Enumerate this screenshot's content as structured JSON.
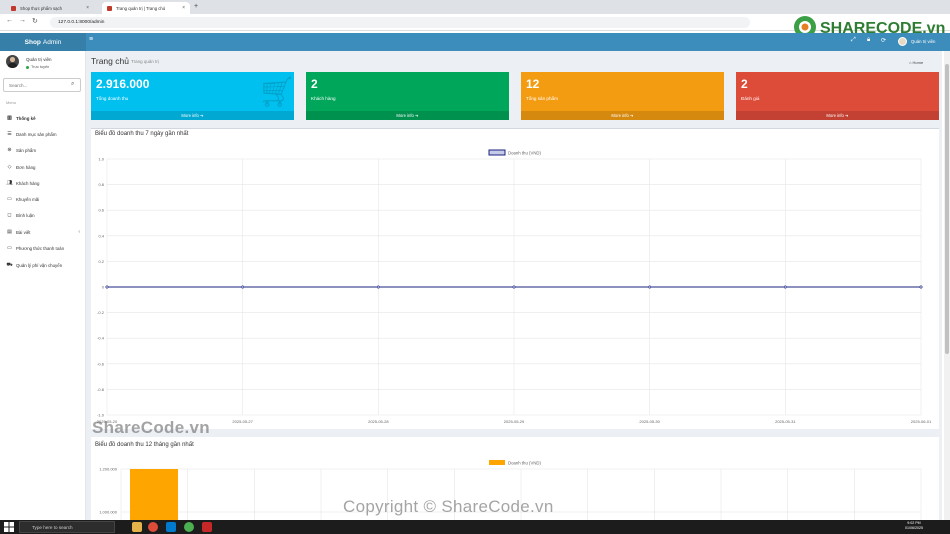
{
  "browser": {
    "tabs": [
      {
        "label": "Shop thực phẩm sạch"
      },
      {
        "label": "Trang quản trị | Trang chủ"
      }
    ],
    "url": "127.0.0.1:8000/admin"
  },
  "watermark": {
    "logo_text": "SHARECODE.vn",
    "mid": "ShareCode.vn",
    "bottom": "Copyright © ShareCode.vn"
  },
  "header": {
    "logo_bold": "Shop",
    "logo_rest": "Admin",
    "user": "Quản trị viên"
  },
  "sidebar": {
    "user_name": "Quản trị viên",
    "status": "Trực tuyến",
    "search_placeholder": "Search...",
    "menu_header": "Menu",
    "items": [
      {
        "label": "Thống kê",
        "icon": "chart-icon"
      },
      {
        "label": "Danh mục sản phẩm",
        "icon": "list-icon"
      },
      {
        "label": "Sản phẩm",
        "icon": "product-icon"
      },
      {
        "label": "Đơn hàng",
        "icon": "diamond-icon"
      },
      {
        "label": "Khách hàng",
        "icon": "users-icon"
      },
      {
        "label": "Khuyến mãi",
        "icon": "ticket-icon"
      },
      {
        "label": "Bình luận",
        "icon": "comment-icon"
      },
      {
        "label": "Bài viết",
        "icon": "article-icon"
      },
      {
        "label": "Phương thức thanh toán",
        "icon": "payment-icon"
      },
      {
        "label": "Quản lý phí vận chuyển",
        "icon": "truck-icon"
      }
    ]
  },
  "page": {
    "title": "Trang chủ",
    "subtitle": "Trang quản trị",
    "breadcrumb": "Home"
  },
  "stats": [
    {
      "value": "2.916.000",
      "label": "Tổng doanh thu",
      "more": "More info",
      "color": "#00c0ef"
    },
    {
      "value": "2",
      "label": "Khách hàng",
      "more": "More info",
      "color": "#00a65a"
    },
    {
      "value": "12",
      "label": "Tổng sản phẩm",
      "more": "More info",
      "color": "#f39c12"
    },
    {
      "value": "2",
      "label": "Đánh giá",
      "more": "More info",
      "color": "#dd4b39"
    }
  ],
  "chart_data": [
    {
      "type": "line",
      "title": "Biểu đồ doanh thu 7 ngày gần nhất",
      "x": [
        "2025-05-20",
        "2025-05-27",
        "2025-05-28",
        "2025-05-29",
        "2025-05-30",
        "2025-05-31",
        "2025-06-01"
      ],
      "series": [
        {
          "name": "Doanh thu (VND)",
          "values": [
            0,
            0,
            0,
            0,
            0,
            0,
            0
          ],
          "color": "#1a237e"
        }
      ],
      "ylim": [
        -1.0,
        1.0
      ],
      "yticks": [
        "1.0",
        "0.8",
        "0.6",
        "0.4",
        "0.2",
        "0",
        "-0.2",
        "-0.4",
        "-0.6",
        "-0.8",
        "-1.0"
      ],
      "legend": "top-center",
      "grid": true
    },
    {
      "type": "bar",
      "title": "Biểu đồ doanh thu 12 tháng gần nhất",
      "series": [
        {
          "name": "Doanh thu (VND)",
          "color": "#ffa500"
        }
      ],
      "yticks": [
        "1.200.000",
        "1.000.000"
      ],
      "legend": "top-center",
      "grid": true
    }
  ],
  "taskbar": {
    "search": "Type here to search",
    "time": "9:02 PM",
    "date": "01/06/2025"
  }
}
